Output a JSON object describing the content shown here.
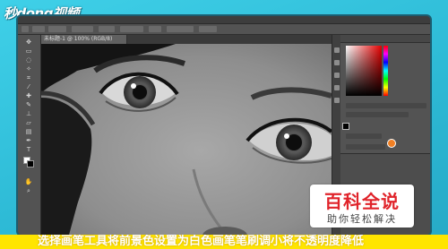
{
  "brand": {
    "logo_text": "秒dong视频"
  },
  "photoshop": {
    "document_tab": "未标题-1 @ 100% (RGB/8)",
    "foreground_color": "#ffffff",
    "background_color": "#000000",
    "tools": [
      "move-tool",
      "marquee-tool",
      "lasso-tool",
      "magic-wand-tool",
      "crop-tool",
      "eyedropper-tool",
      "healing-tool",
      "brush-tool",
      "clone-stamp-tool",
      "history-brush-tool",
      "eraser-tool",
      "gradient-tool",
      "dodge-tool",
      "pen-tool",
      "type-tool",
      "path-select-tool",
      "shape-tool",
      "hand-tool",
      "zoom-tool"
    ]
  },
  "badge": {
    "title": "百科全说",
    "subtitle": "助你轻松解决"
  },
  "caption": {
    "text": "选择画笔工具将前景色设置为白色画笔笔刷调小将不透明度降低"
  },
  "colors": {
    "accent": "#32c3dd",
    "caption_bg": "#ffe500",
    "badge_title": "#e0232a"
  }
}
